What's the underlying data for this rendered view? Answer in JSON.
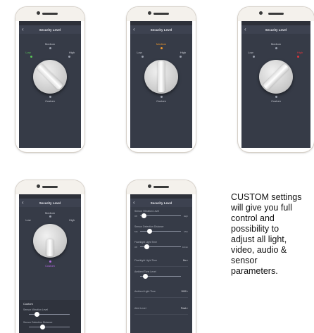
{
  "screen_title": "Security Level",
  "levels": {
    "low": "Low",
    "medium": "Medium",
    "high": "High",
    "custom": "Custom"
  },
  "accent_colors": {
    "low": "#59c757",
    "medium": "#f0982c",
    "high": "#e0353c",
    "custom": "#b36ae2"
  },
  "custom_panel": {
    "header": "Custom",
    "sliders": [
      {
        "label": "Sensor Vibration Level",
        "min": "Off",
        "max": "High"
      },
      {
        "label": "Sensor Detection Distance",
        "min": "Min",
        "max": "Max"
      },
      {
        "label": "Flashlight Light Time",
        "min": "Off",
        "max": "10min"
      }
    ],
    "rows": [
      {
        "label": "Flashlight Light Time",
        "value": "8m ›"
      },
      {
        "label": "Ambient Tone Level",
        "value": ""
      },
      {
        "label": "Ambient Light Time",
        "value": "1000 ›"
      },
      {
        "label": "Alert Level",
        "value": "Peak ›"
      }
    ]
  },
  "caption": [
    "CUSTOM settings",
    "will give you full",
    "control and",
    "possibility to",
    "adjust all light,",
    "video, audio &",
    "sensor",
    "parameters."
  ]
}
